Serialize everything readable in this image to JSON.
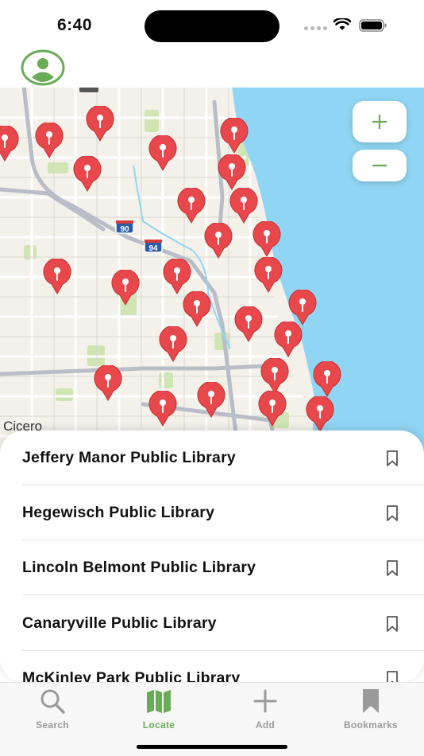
{
  "status": {
    "time": "6:40"
  },
  "colors": {
    "accent": "#6aab58",
    "pin": "#e8484b",
    "water": "#90d6f4",
    "tab_inactive": "#9a9a9a"
  },
  "header": {
    "profile_icon": "person-circle-icon"
  },
  "map": {
    "place_label": "Cicero",
    "highway_shields": [
      "90",
      "94"
    ],
    "zoom_in_icon": "plus-icon",
    "zoom_out_icon": "minus-icon"
  },
  "libraries": [
    {
      "name": "Jeffery Manor Public Library"
    },
    {
      "name": "Hegewisch Public Library"
    },
    {
      "name": "Lincoln Belmont Public Library"
    },
    {
      "name": "Canaryville Public Library"
    },
    {
      "name": "McKinley Park Public Library"
    }
  ],
  "tabs": [
    {
      "label": "Search",
      "icon": "magnifier-icon"
    },
    {
      "label": "Locate",
      "icon": "map-icon",
      "active": true
    },
    {
      "label": "Add",
      "icon": "plus-icon"
    },
    {
      "label": "Bookmarks",
      "icon": "bookmark-icon"
    }
  ]
}
